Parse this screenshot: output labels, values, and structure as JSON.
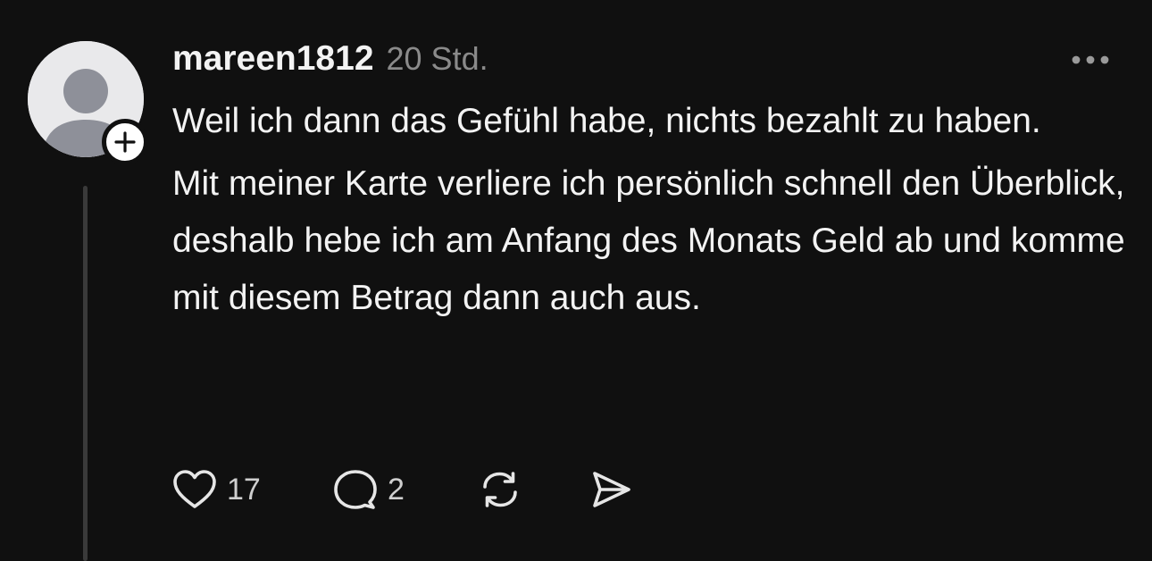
{
  "post": {
    "username": "mareen1812",
    "timestamp": "20 Std.",
    "paragraphs": [
      "Weil ich dann das Gefühl habe, nichts bezahlt zu haben.",
      "Mit meiner Karte verliere ich persönlich schnell den Überblick, deshalb hebe ich am Anfang des Monats Geld ab und komme mit diesem Betrag dann auch aus."
    ],
    "likes": "17",
    "replies": "2"
  },
  "icons": {
    "avatar": "default-avatar-icon",
    "follow": "plus-icon",
    "more": "more-dots-icon",
    "like": "heart-icon",
    "reply": "comment-bubble-icon",
    "repost": "repost-icon",
    "share": "send-icon"
  },
  "colors": {
    "background": "#101010",
    "text": "#f3f3f3",
    "muted": "#8a8a8a",
    "thread_line": "#3a3a3a"
  }
}
